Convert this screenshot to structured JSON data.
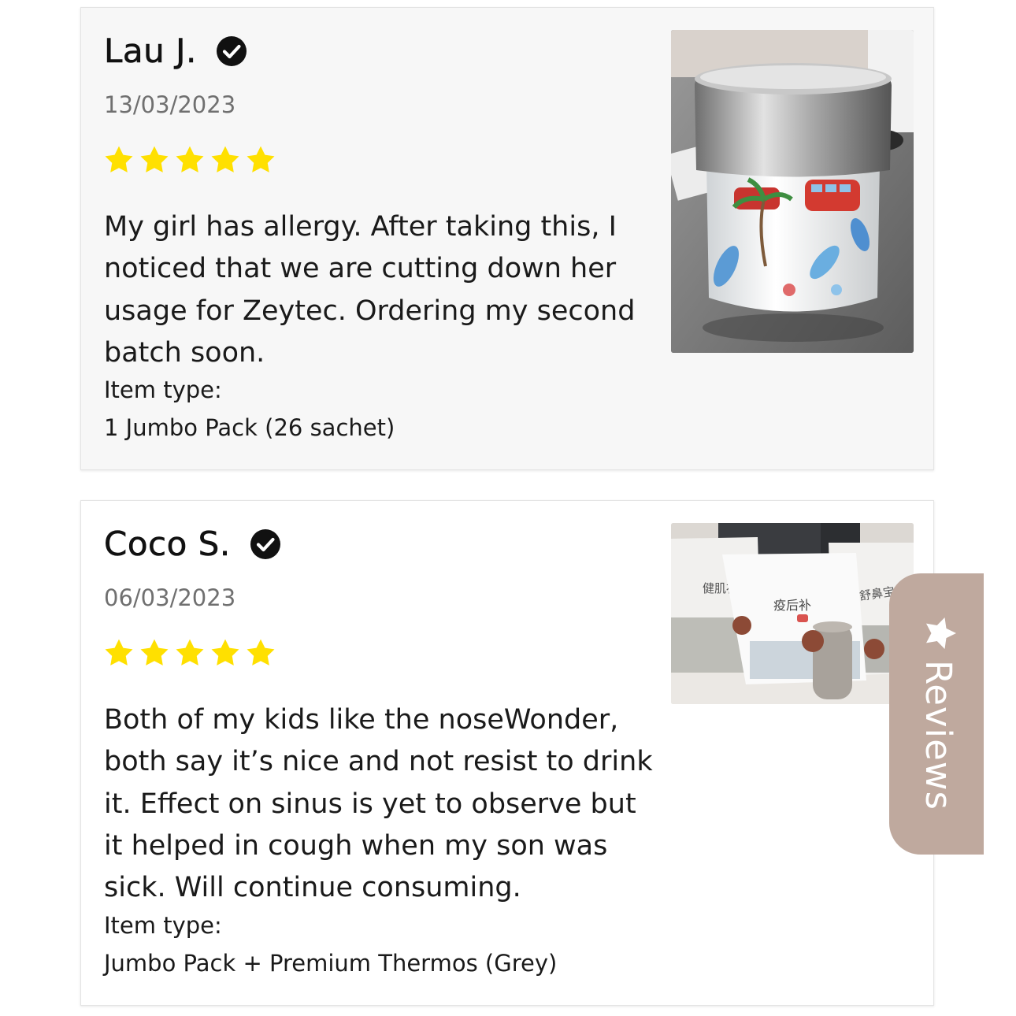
{
  "reviews": [
    {
      "name": "Lau J.",
      "date": "13/03/2023",
      "rating": 5,
      "body": "My girl has allergy.  After taking this, I noticed that we are cutting down her usage for Zeytec. Ordering my second batch soon.",
      "item_label": "Item type:",
      "item_value": "1 Jumbo Pack (26 sachet)"
    },
    {
      "name": "Coco S.",
      "date": "06/03/2023",
      "rating": 5,
      "body": "Both of my kids like the noseWonder, both say it’s nice and not resist to drink it. Effect on sinus is yet to observe but it helped in cough when my son was sick. Will continue consuming.",
      "item_label": "Item type:",
      "item_value": "Jumbo Pack + Premium Thermos (Grey)",
      "photo_labels": [
        "健肌补",
        "疫后补",
        "舒鼻宝"
      ]
    }
  ],
  "reviews_tab": {
    "label": "Reviews",
    "color": "#bfa99e"
  },
  "colors": {
    "star": "#ffe000",
    "date_text": "#707070",
    "tab": "#bfa99e"
  },
  "icons": {
    "verified": "verified-badge-icon",
    "star": "star-icon",
    "tab_star": "star-icon"
  }
}
